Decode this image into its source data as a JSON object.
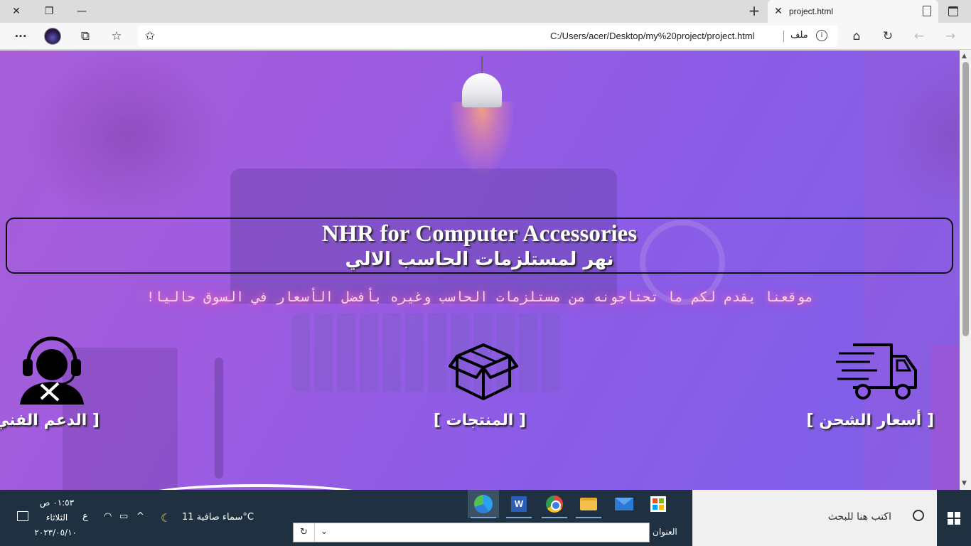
{
  "browser": {
    "tab_title": "project.html",
    "new_tab": "+",
    "url": "C:/Users/acer/Desktop/my%20project/project.html",
    "file_label": "ملف",
    "menu_icon": "ellipsis-icon"
  },
  "page": {
    "title_en": "NHR for Computer Accessories",
    "title_ar": "نهر لمستلزمات الحاسب الالي",
    "tagline": "موقعنا يقدم لكم ما تحتاجونه من مستلزمات الحاسب وغيره بأفضل الأسعار في السوق حاليا!",
    "features": [
      {
        "label": "[ الدعم الفني ]",
        "icon": "support-agent-icon"
      },
      {
        "label": "[ المنتجات ]",
        "icon": "box-icon"
      },
      {
        "label": "[ أسعار الشحن ]",
        "icon": "delivery-truck-icon"
      }
    ]
  },
  "taskbar": {
    "search_placeholder": "اكتب هنا للبحث",
    "address_label": "العنوان",
    "weather": "سماء صافية  11°C",
    "time": "٠١:٥٣ ص",
    "day": "الثلاثاء",
    "date": "٢٠٢٣/٠٥/١٠",
    "lang": "ع",
    "go_symbol": "↻"
  },
  "colors": {
    "page_gradient_start": "#a75ed8",
    "page_gradient_end": "#7d60ea",
    "taskbar": "#1f3140"
  }
}
